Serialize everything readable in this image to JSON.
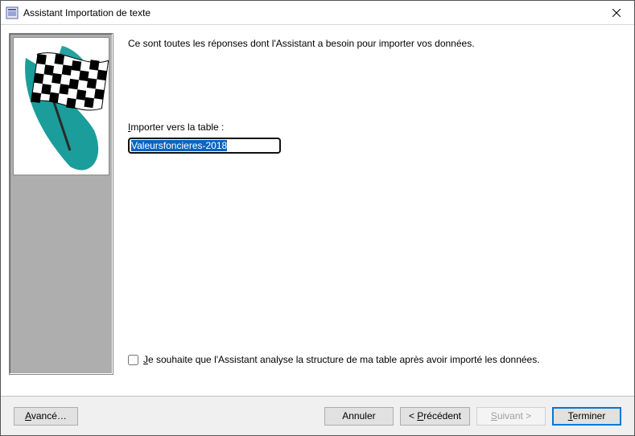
{
  "window": {
    "title": "Assistant Importation de texte"
  },
  "main": {
    "intro": "Ce sont toutes les réponses dont l'Assistant a besoin pour importer vos données.",
    "import_label_pre": "I",
    "import_label_rest": "mporter vers la table :",
    "table_name": "Valeursfoncieres-2018",
    "analyze_pre": "J",
    "analyze_rest": "e souhaite que l'Assistant analyse la structure de ma table après avoir importé les données."
  },
  "buttons": {
    "advanced_pre": "A",
    "advanced_rest": "vancé…",
    "cancel": "Annuler",
    "back_prefix": "<  ",
    "back_pre": "P",
    "back_rest": "récédent",
    "next_pre": "S",
    "next_rest": "uivant >",
    "finish_pre": "T",
    "finish_rest": "erminer"
  }
}
